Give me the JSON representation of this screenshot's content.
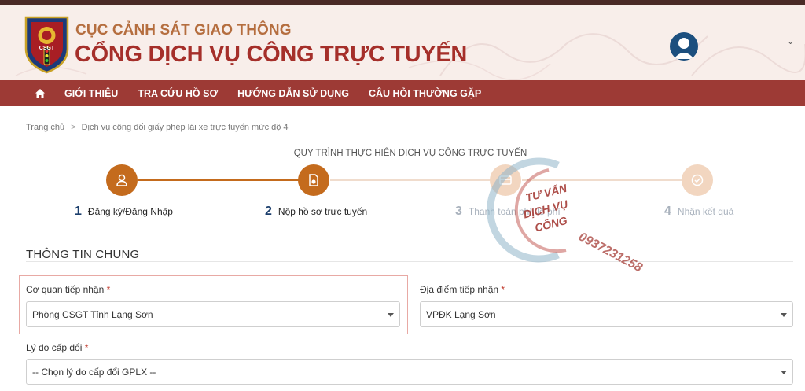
{
  "header": {
    "subtitle": "CỤC CẢNH SÁT GIAO THÔNG",
    "title": "CỔNG DỊCH VỤ CÔNG TRỰC TUYẾN",
    "logo_text": "CSGT"
  },
  "nav": {
    "items": [
      "GIỚI THIỆU",
      "TRA CỨU HỒ SƠ",
      "HƯỚNG DẪN SỬ DỤNG",
      "CÂU HỎI THƯỜNG GẶP"
    ]
  },
  "breadcrumb": {
    "home": "Trang chủ",
    "current": "Dịch vụ công đổi giấy phép lái xe trực tuyến mức độ 4"
  },
  "process": {
    "title": "QUY TRÌNH THỰC HIỆN DỊCH VỤ CÔNG TRỰC TUYẾN",
    "steps": [
      {
        "num": "1",
        "label": "Đăng ký/Đăng Nhập"
      },
      {
        "num": "2",
        "label": "Nộp hồ sơ trực tuyến"
      },
      {
        "num": "3",
        "label": "Thanh toán phí, lệ phí"
      },
      {
        "num": "4",
        "label": "Nhận kết quả"
      }
    ],
    "current_step": 2
  },
  "form": {
    "section_title": "THÔNG TIN CHUNG",
    "agency_label": "Cơ quan tiếp nhận",
    "agency_value": "Phòng CSGT Tỉnh Lạng Sơn",
    "location_label": "Địa điểm tiếp nhận",
    "location_value": "VPĐK Lạng Sơn",
    "reason_label": "Lý do cấp đổi",
    "reason_value": "-- Chọn lý do cấp đổi GPLX --",
    "required_mark": "*"
  },
  "watermark": {
    "line1": "TƯ VẤN",
    "line2": "DỊCH VỤ",
    "line3": "CÔNG",
    "phone": "0937231258"
  },
  "colors": {
    "brand_red": "#9d3a35",
    "title_red": "#a52f2a",
    "step_active": "#c46b1d",
    "step_inactive": "#f2d6c0"
  }
}
